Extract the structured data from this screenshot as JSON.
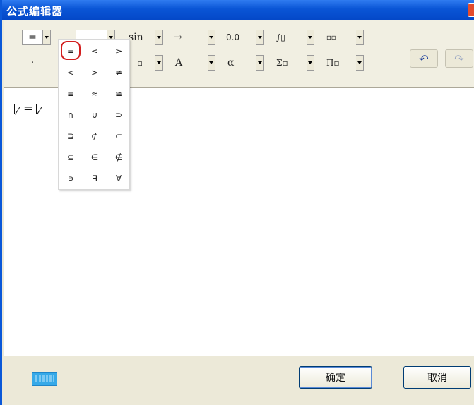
{
  "window": {
    "title": "公式编辑器",
    "close_icon": "close-icon"
  },
  "toolbar": {
    "row1": [
      {
        "name": "relation-template-button",
        "label": "="
      },
      {
        "name": "fraction-template-button",
        "label": ""
      },
      {
        "name": "function-template-button",
        "label": "sin"
      },
      {
        "name": "arrow-template-button",
        "label": "→"
      },
      {
        "name": "decoration-template-button",
        "label": "0.0"
      },
      {
        "name": "integral-template-button",
        "label": "∫▯"
      },
      {
        "name": "matrix-template-button",
        "label": "▫▫"
      }
    ],
    "row2": [
      {
        "name": "dot-template-button",
        "label": "·"
      },
      {
        "name": "fraction2-template-button",
        "label": "▫"
      },
      {
        "name": "font-template-button",
        "label": "A"
      },
      {
        "name": "greek-template-button",
        "label": "α"
      },
      {
        "name": "sum-template-button",
        "label": "Σ▫"
      },
      {
        "name": "product-template-button",
        "label": "Π▫"
      }
    ],
    "undo_icon": "undo-icon",
    "redo_icon": "redo-icon"
  },
  "editor": {
    "formula": "="
  },
  "relation_dropdown": {
    "selected": "=",
    "symbols": [
      "=",
      "≤",
      "≥",
      "<",
      ">",
      "≠",
      "≡",
      "≈",
      "≅",
      "∩",
      "∪",
      "⊃",
      "⊇",
      "⊄",
      "⊂",
      "⊆",
      "∈",
      "∉",
      "∍",
      "∃",
      "∀"
    ]
  },
  "footer": {
    "keyboard_icon": "keyboard-icon",
    "ok_label": "确定",
    "cancel_label": "取消"
  },
  "colors": {
    "titlebar": "#0a55d6",
    "selection_ring": "#d21e1e",
    "window_bg": "#ece9d8"
  }
}
